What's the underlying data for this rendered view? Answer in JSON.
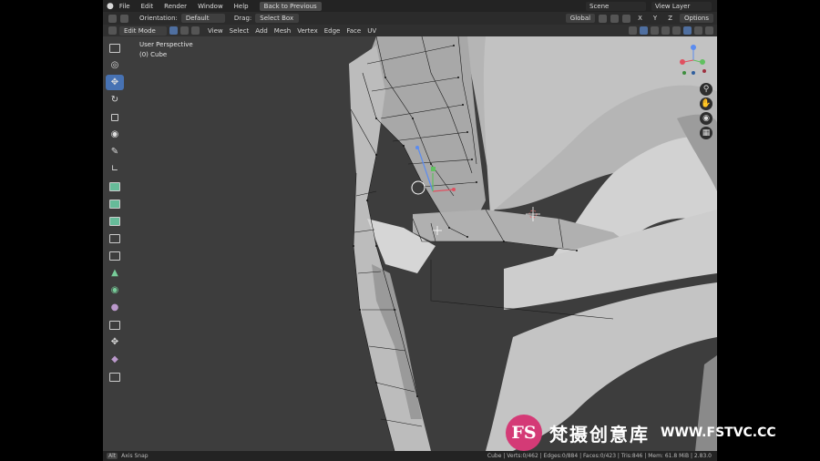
{
  "menus": [
    "File",
    "Edit",
    "Render",
    "Window",
    "Help"
  ],
  "back_button": "Back to Previous",
  "scene": "Scene",
  "view_layer": "View Layer",
  "header": {
    "orientation_label": "Orientation:",
    "orientation_value": "Default",
    "drag_label": "Drag:",
    "drag_value": "Select Box",
    "transform_space": "Global",
    "axes": [
      "X",
      "Y",
      "Z"
    ],
    "options": "Options"
  },
  "editbar": {
    "mode": "Edit Mode",
    "menus": [
      "View",
      "Select",
      "Add",
      "Mesh",
      "Vertex",
      "Edge",
      "Face",
      "UV"
    ]
  },
  "viewport": {
    "perspective": "User Perspective",
    "object": "(0) Cube"
  },
  "status": {
    "left_key": "Alt",
    "left_text": "Axis Snap",
    "right_text": "Cube | Verts:0/462 | Edges:0/884 | Faces:0/423 | Tris:846 | Mem: 61.8 MiB | 2.83.0"
  },
  "watermark": {
    "logo": "FS",
    "chinese": "梵摄创意库",
    "url": "WWW.FSTVC.CC"
  },
  "colors": {
    "accent": "#4772b3",
    "viewport": "#3d3d3d",
    "mesh": "#bdbdbd",
    "header": "#232323",
    "watermark_pink": "#d43a76"
  }
}
